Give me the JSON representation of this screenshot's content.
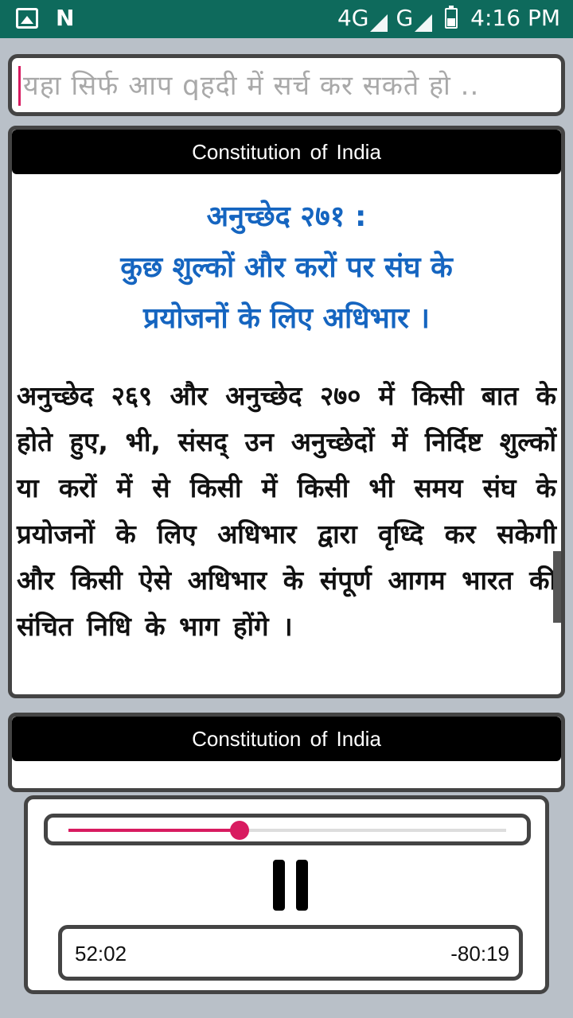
{
  "status_bar": {
    "network_1": "4G",
    "network_2": "G",
    "time": "4:16 PM",
    "icons": [
      "image-icon",
      "n-app-icon",
      "signal-icon",
      "battery-icon"
    ]
  },
  "search": {
    "placeholder": "यहा सिर्फ आप qहदी में सर्च कर सकते हो .."
  },
  "cards": [
    {
      "header": "Constitution of India",
      "title_lines": [
        "अनुच्छेद २७१ :",
        "कुछ शुल्कों और करों पर संघ के",
        "प्रयोजनों के लिए अधिभार ।"
      ],
      "body": "अनुच्छेद २६९ और अनुच्छेद २७० में किसी बात के होते हुए, भी, संसद् उन अनुच्छेदों में निर्दिष्ट शुल्कों या करों में से किसी में किसी भी समय संघ के प्रयोजनों के लिए अधिभार द्वारा वृध्दि कर सकेगी और किसी ऐसे अधिभार के संपूर्ण आगम भारत की संचित निधि के भाग होंगे ।"
    },
    {
      "header": "Constitution of India"
    }
  ],
  "player": {
    "progress": 0.39,
    "elapsed": "52:02",
    "remaining": "-80:19",
    "state": "playing",
    "accent_color": "#d81b60"
  }
}
